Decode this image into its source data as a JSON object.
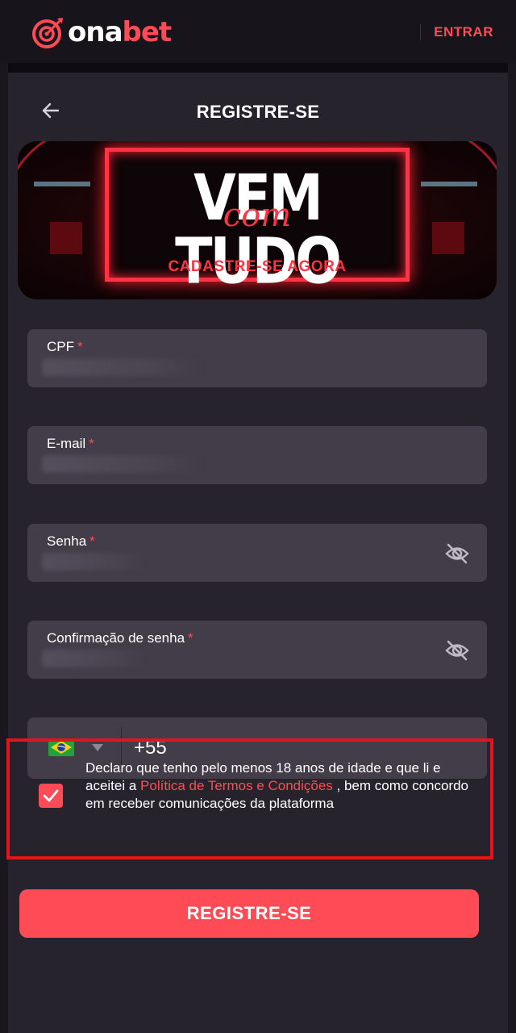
{
  "topbar": {
    "logo_text_white": "ona",
    "logo_text_red": "bet",
    "login_label": "ENTRAR"
  },
  "header": {
    "title": "REGISTRE-SE",
    "back_icon": "arrow-left-icon"
  },
  "banner": {
    "headline": "VEM TUDO",
    "script": "com",
    "subheadline": "CADASTRE-SE AGORA"
  },
  "form": {
    "cpf_label": "CPF",
    "email_label": "E-mail",
    "password_label": "Senha",
    "confirm_password_label": "Confirmação de senha",
    "required_mark": "*",
    "password_toggle_icon": "eye-off-icon",
    "phone_country_icon": "brazil-flag-icon",
    "phone_code": "+55"
  },
  "terms": {
    "checked": true,
    "text_before": "Declaro que tenho pelo menos 18 anos de idade e que li e aceitei a ",
    "link_text": "Política de Termos e Condições",
    "text_after": " , bem como concordo em receber comunicações da plataforma"
  },
  "submit": {
    "label": "REGISTRE-SE"
  },
  "colors": {
    "accent": "#ff4b55",
    "background": "#1a171e",
    "panel": "#27232c",
    "field": "#433c49",
    "highlight_border": "#e4141c"
  }
}
